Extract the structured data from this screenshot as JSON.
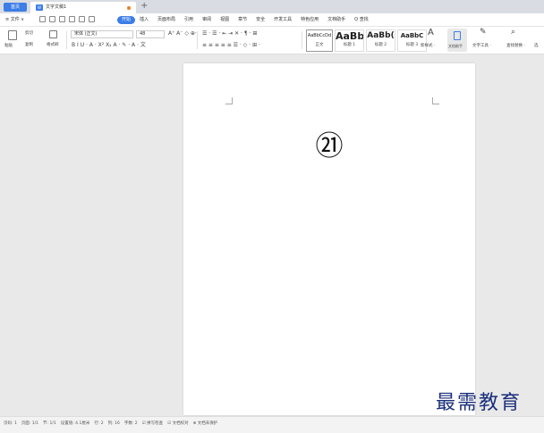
{
  "tabs": {
    "home": "首页",
    "doc_icon": "W",
    "doc_title": "文字文稿1",
    "add": "+"
  },
  "menubar": {
    "file": "≡ 文件 ∨",
    "items": [
      "开始",
      "插入",
      "页面布局",
      "引用",
      "审阅",
      "视图",
      "章节",
      "安全",
      "开发工具",
      "特色应用",
      "文档助手",
      "Q 查找"
    ]
  },
  "ribbon": {
    "paste": "粘贴",
    "cut": "剪切",
    "copy": "复制",
    "format_painter": "格式刷",
    "font_name": "宋体 (正文)",
    "font_size": "48",
    "format_row": "B  I  U · A · X² X₂  A · ✎ · A · 文",
    "para_row1": "☰ · ☰ · ⇤ ⇥  ✕ · ¶ · ⊞",
    "para_row2": "≡  ≡  ≡  ≡  ≡  ☰ · ◇ · ⊞ ·",
    "styles": [
      {
        "sample": "AaBbCcDd",
        "name": "正文"
      },
      {
        "sample": "AaBb",
        "name": "标题 1"
      },
      {
        "sample": "AaBb(",
        "name": "标题 2"
      },
      {
        "sample": "AaBbC",
        "name": "标题 3"
      }
    ],
    "new_style": "新样式 ·",
    "doc_helper": "文档助手",
    "text_tools": "文字工具 ·",
    "find_replace": "查找替换 ·",
    "select": "选"
  },
  "document": {
    "content": "㉑"
  },
  "statusbar": {
    "items": [
      "页码: 1",
      "页面: 1/1",
      "节: 1/1",
      "设置值: 4.1厘米",
      "行: 2",
      "列: 16",
      "字数: 2",
      "☑ 拼写检查",
      "☑ 文档校对",
      "⊕ 文档未保护"
    ]
  },
  "watermark": "最需教育"
}
